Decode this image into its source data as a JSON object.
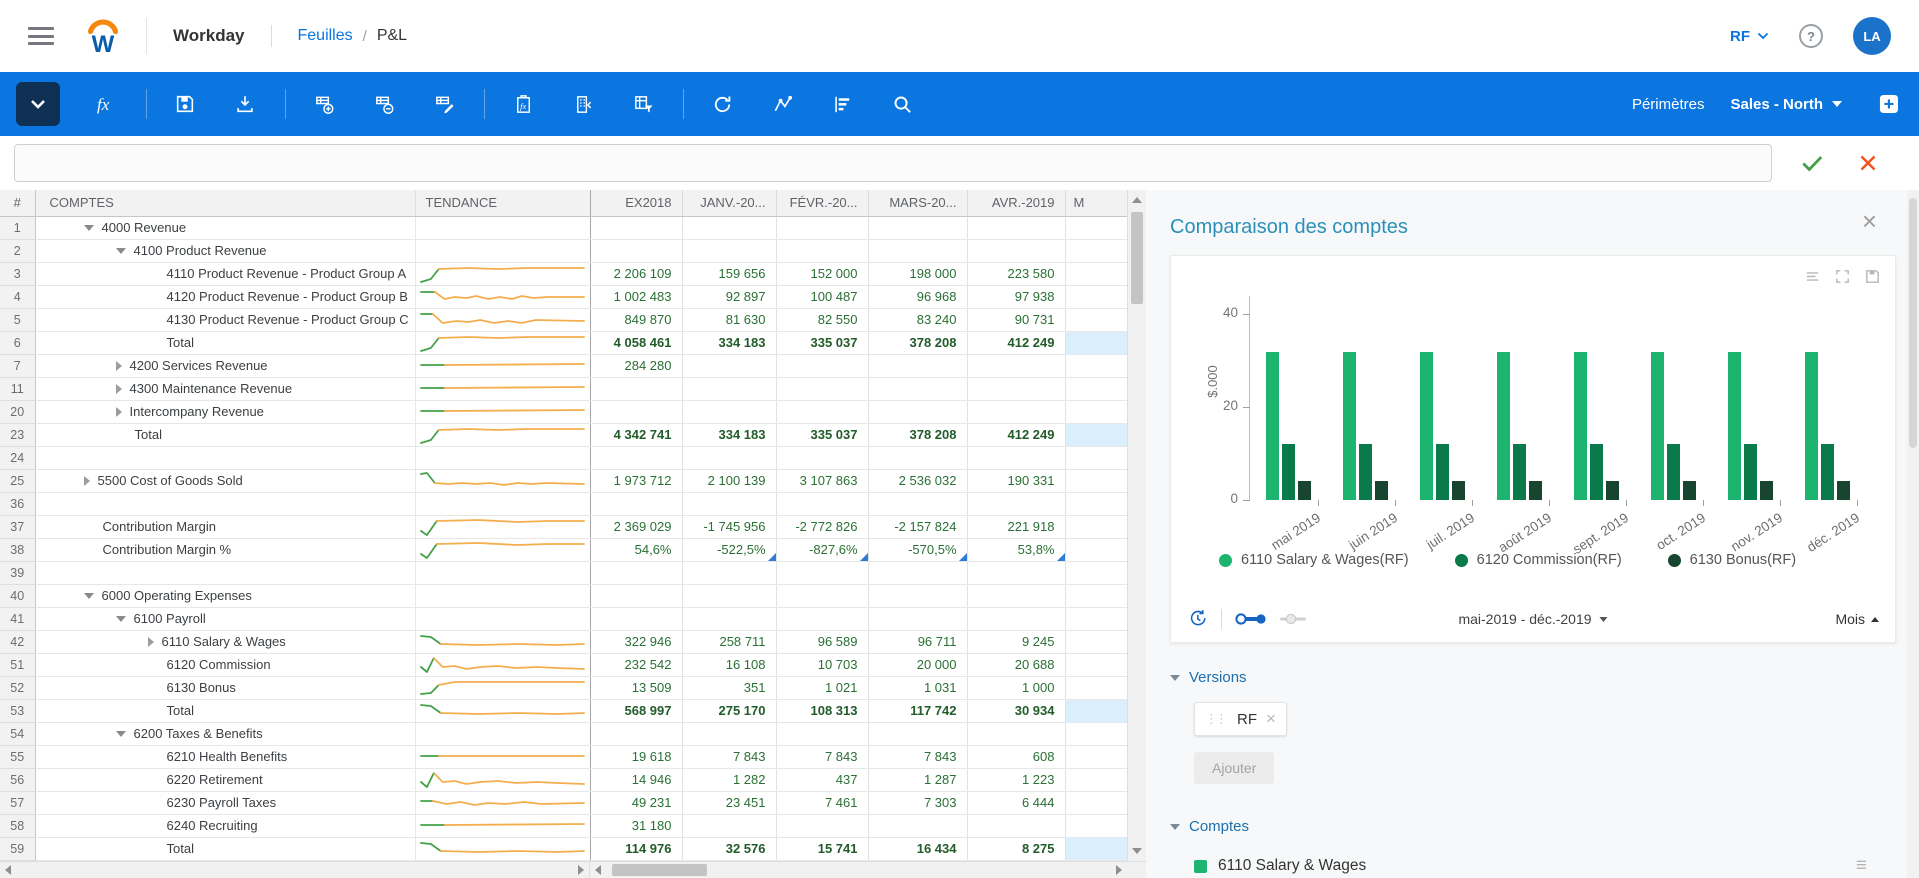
{
  "header": {
    "app_title": "Workday",
    "breadcrumb": {
      "section": "Feuilles",
      "separator": "/",
      "current": "P&L"
    },
    "version_selector": "RF",
    "avatar_initials": "LA"
  },
  "toolbar": {
    "perimeters_label": "Périmètres",
    "perimeter_value": "Sales - North"
  },
  "formula_bar": {
    "value": ""
  },
  "table": {
    "columns": {
      "num": "#",
      "account": "COMPTES",
      "trend": "TENDANCE",
      "periods": [
        "EX2018",
        "JANV.-20...",
        "FÉVR.-20...",
        "MARS-20...",
        "AVR.-2019"
      ],
      "next_period_truncated": "M"
    },
    "rows": [
      {
        "n": "1",
        "level": 1,
        "caret": "down",
        "account": "4000 Revenue",
        "bold": false,
        "spark": null,
        "values": [
          "",
          "",
          "",
          "",
          ""
        ],
        "m": ""
      },
      {
        "n": "2",
        "level": 2,
        "caret": "down",
        "account": "4100 Product Revenue",
        "bold": false,
        "spark": null,
        "values": [
          "",
          "",
          "",
          "",
          ""
        ],
        "m": ""
      },
      {
        "n": "3",
        "level": 3,
        "caret": null,
        "account": "4110 Product Revenue - Product Group A",
        "bold": false,
        "spark": "riseflat",
        "values": [
          "2 206 109",
          "159 656",
          "152 000",
          "198 000",
          "223 580"
        ],
        "m": ""
      },
      {
        "n": "4",
        "level": 3,
        "caret": null,
        "account": "4120 Product Revenue - Product Group B",
        "bold": false,
        "spark": "dipwavy",
        "values": [
          "1 002 483",
          "92 897",
          "100 487",
          "96 968",
          "97 938"
        ],
        "m": ""
      },
      {
        "n": "5",
        "level": 3,
        "caret": null,
        "account": "4130 Product Revenue - Product Group C",
        "bold": false,
        "spark": "dipwavy2",
        "values": [
          "849 870",
          "81 630",
          "82 550",
          "83 240",
          "90 731"
        ],
        "m": ""
      },
      {
        "n": "6",
        "level": 3,
        "caret": null,
        "account": "Total",
        "bold": true,
        "spark": "riseflat",
        "values": [
          "4 058 461",
          "334 183",
          "335 037",
          "378 208",
          "412 249"
        ],
        "m": "hl"
      },
      {
        "n": "7",
        "level": 2,
        "caret": "right",
        "account": "4200 Services Revenue",
        "bold": false,
        "spark": "flat",
        "values": [
          "284 280",
          "",
          "",
          "",
          ""
        ],
        "m": ""
      },
      {
        "n": "11",
        "level": 2,
        "caret": "right",
        "account": "4300 Maintenance Revenue",
        "bold": false,
        "spark": "flat",
        "values": [
          "",
          "",
          "",
          "",
          ""
        ],
        "m": ""
      },
      {
        "n": "20",
        "level": 2,
        "caret": "right",
        "account": "Intercompany Revenue",
        "bold": false,
        "spark": "flat",
        "values": [
          "",
          "",
          "",
          "",
          ""
        ],
        "m": ""
      },
      {
        "n": "23",
        "level": 2,
        "caret": null,
        "account": "Total",
        "bold": true,
        "spark": "riseflat",
        "values": [
          "4 342 741",
          "334 183",
          "335 037",
          "378 208",
          "412 249"
        ],
        "m": "hl"
      },
      {
        "n": "24",
        "level": 0,
        "caret": null,
        "account": "",
        "bold": false,
        "spark": null,
        "values": [
          "",
          "",
          "",
          "",
          ""
        ],
        "m": ""
      },
      {
        "n": "25",
        "level": 1,
        "caret": "right",
        "account": "5500 Cost of Goods Sold",
        "bold": false,
        "spark": "fallwavy",
        "values": [
          "1 973 712",
          "2 100 139",
          "3 107 863",
          "2 536 032",
          "190 331"
        ],
        "m": ""
      },
      {
        "n": "36",
        "level": 0,
        "caret": null,
        "account": "",
        "bold": false,
        "spark": null,
        "values": [
          "",
          "",
          "",
          "",
          ""
        ],
        "m": ""
      },
      {
        "n": "37",
        "level": 1,
        "caret": null,
        "account": "Contribution Margin",
        "bold": false,
        "spark": "checkflat",
        "values": [
          "2 369 029",
          "-1 745 956",
          "-2 772 826",
          "-2 157 824",
          "221 918"
        ],
        "m": ""
      },
      {
        "n": "38",
        "level": 1,
        "caret": null,
        "account": "Contribution Margin %",
        "bold": false,
        "spark": "checkflat",
        "values": [
          "54,6%",
          "-522,5%",
          "-827,6%",
          "-570,5%",
          "53,8%"
        ],
        "flags": [
          0,
          1,
          1,
          1,
          1
        ],
        "m": ""
      },
      {
        "n": "39",
        "level": 0,
        "caret": null,
        "account": "",
        "bold": false,
        "spark": null,
        "values": [
          "",
          "",
          "",
          "",
          ""
        ],
        "m": ""
      },
      {
        "n": "40",
        "level": 1,
        "caret": "down",
        "account": "6000 Operating Expenses",
        "bold": false,
        "spark": null,
        "values": [
          "",
          "",
          "",
          "",
          ""
        ],
        "m": ""
      },
      {
        "n": "41",
        "level": 2,
        "caret": "down",
        "account": "6100 Payroll",
        "bold": false,
        "spark": null,
        "values": [
          "",
          "",
          "",
          "",
          ""
        ],
        "m": ""
      },
      {
        "n": "42",
        "level": 3,
        "caret": "right",
        "account": "6110 Salary & Wages",
        "bold": false,
        "spark": "fallflat",
        "values": [
          "322 946",
          "258 711",
          "96 589",
          "96 711",
          "9 245"
        ],
        "m": ""
      },
      {
        "n": "51",
        "level": 3,
        "caret": null,
        "account": "6120 Commission",
        "bold": false,
        "spark": "checkwavy",
        "values": [
          "232 542",
          "16 108",
          "10 703",
          "20 000",
          "20 688"
        ],
        "m": ""
      },
      {
        "n": "52",
        "level": 3,
        "caret": null,
        "account": "6130 Bonus",
        "bold": false,
        "spark": "stepup",
        "values": [
          "13 509",
          "351",
          "1 021",
          "1 031",
          "1 000"
        ],
        "m": ""
      },
      {
        "n": "53",
        "level": 3,
        "caret": null,
        "account": "Total",
        "bold": true,
        "spark": "fallflat",
        "values": [
          "568 997",
          "275 170",
          "108 313",
          "117 742",
          "30 934"
        ],
        "m": "hl"
      },
      {
        "n": "54",
        "level": 2,
        "caret": "down",
        "account": "6200 Taxes & Benefits",
        "bold": false,
        "spark": null,
        "values": [
          "",
          "",
          "",
          "",
          ""
        ],
        "m": ""
      },
      {
        "n": "55",
        "level": 3,
        "caret": null,
        "account": "6210 Health Benefits",
        "bold": false,
        "spark": "flat2",
        "values": [
          "19 618",
          "7 843",
          "7 843",
          "7 843",
          "608"
        ],
        "m": ""
      },
      {
        "n": "56",
        "level": 3,
        "caret": null,
        "account": "6220 Retirement",
        "bold": false,
        "spark": "checkwavy",
        "values": [
          "14 946",
          "1 282",
          "437",
          "1 287",
          "1 223"
        ],
        "m": ""
      },
      {
        "n": "57",
        "level": 3,
        "caret": null,
        "account": "6230 Payroll Taxes",
        "bold": false,
        "spark": "wavy",
        "values": [
          "49 231",
          "23 451",
          "7 461",
          "7 303",
          "6 444"
        ],
        "m": ""
      },
      {
        "n": "58",
        "level": 3,
        "caret": null,
        "account": "6240 Recruiting",
        "bold": false,
        "spark": "flat",
        "values": [
          "31 180",
          "",
          "",
          "",
          ""
        ],
        "m": ""
      },
      {
        "n": "59",
        "level": 3,
        "caret": null,
        "account": "Total",
        "bold": true,
        "spark": "fallflat",
        "values": [
          "114 976",
          "32 576",
          "15 741",
          "16 434",
          "8 275"
        ],
        "m": "hl"
      }
    ]
  },
  "panel": {
    "title": "Comparaison des comptes",
    "chart_data": {
      "type": "bar",
      "title": "Comparaison des comptes",
      "categories": [
        "mai 2019",
        "juin 2019",
        "juil. 2019",
        "août 2019",
        "sept. 2019",
        "oct. 2019",
        "nov. 2019",
        "déc. 2019"
      ],
      "series": [
        {
          "name": "6110 Salary & Wages(RF)",
          "color": "#1db470",
          "values": [
            32,
            32,
            32,
            32,
            32,
            32,
            32,
            32
          ]
        },
        {
          "name": "6120 Commission(RF)",
          "color": "#0a7a4b",
          "values": [
            12,
            12,
            12,
            12,
            12,
            12,
            12,
            12
          ]
        },
        {
          "name": "6130 Bonus(RF)",
          "color": "#17452f",
          "values": [
            4,
            4,
            4,
            4,
            4,
            4,
            4,
            4
          ]
        }
      ],
      "ylabel": "$.000",
      "yticks": [
        0,
        20,
        40
      ],
      "ylim": [
        0,
        44
      ],
      "legend_position": "bottom",
      "grid": false
    },
    "chart_controls": {
      "date_range": "mai-2019 - déc.-2019",
      "group_by": "Mois"
    },
    "versions": {
      "label": "Versions",
      "chips": [
        "RF"
      ],
      "add_button": "Ajouter"
    },
    "accounts": {
      "label": "Comptes",
      "items": [
        {
          "label": "6110 Salary & Wages",
          "color": "#1db470"
        }
      ]
    }
  },
  "colors": {
    "toolbar_blue": "#0b76e0",
    "link_blue": "#0875e1",
    "value_green": "#2a7034",
    "spark_green": "#43a047",
    "spark_orange": "#f4ae4e",
    "highlight_cell": "#dbeefb",
    "panel_title_teal": "#2b90b9",
    "section_blue": "#1b6fae",
    "avatar_blue": "#1a73c8"
  }
}
